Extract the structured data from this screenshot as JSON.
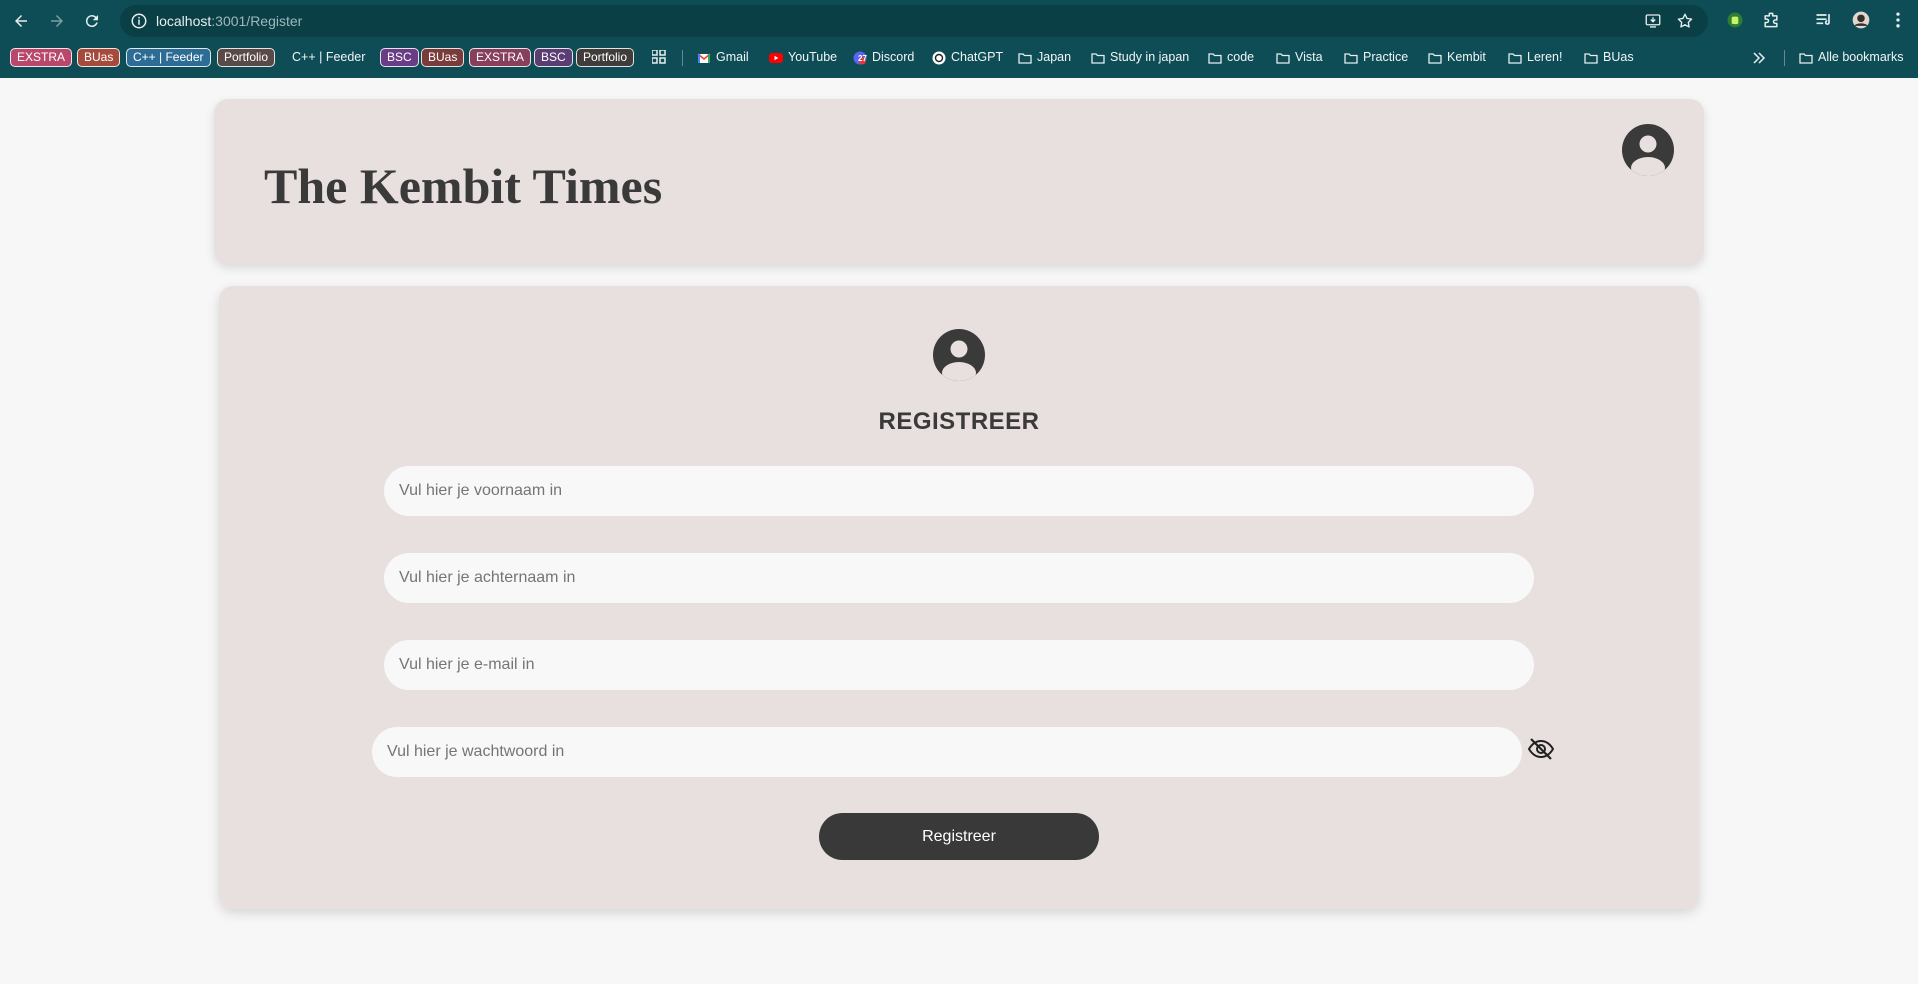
{
  "browser": {
    "url_host": "localhost",
    "url_path": ":3001/Register",
    "bookmarks_tags": [
      {
        "label": "EXSTRA",
        "color": "#b9476c"
      },
      {
        "label": "BUas",
        "color": "#a64a3c"
      },
      {
        "label": "C++ | Feeder",
        "color": "#2d6d95"
      },
      {
        "label": "Portfolio",
        "color": "#5a4a47"
      },
      {
        "label": "C++ | Feeder",
        "color": "transparent"
      },
      {
        "label": "BSC",
        "color": "#6b3c86"
      },
      {
        "label": "BUas",
        "color": "#7a3b3b"
      },
      {
        "label": "EXSTRA",
        "color": "#873f5c"
      },
      {
        "label": "BSC",
        "color": "#5b3d74"
      },
      {
        "label": "Portfolio",
        "color": "#3f3c3b"
      }
    ],
    "bookmark_links": [
      {
        "label": "Gmail",
        "icon": "gmail-icon"
      },
      {
        "label": "YouTube",
        "icon": "youtube-icon"
      },
      {
        "label": "Discord",
        "icon": "discord-icon"
      },
      {
        "label": "ChatGPT",
        "icon": "chatgpt-icon"
      },
      {
        "label": "Japan",
        "icon": "folder-icon"
      },
      {
        "label": "Study in japan",
        "icon": "folder-icon"
      },
      {
        "label": "code",
        "icon": "folder-icon"
      },
      {
        "label": "Vista",
        "icon": "folder-icon"
      },
      {
        "label": "Practice",
        "icon": "folder-icon"
      },
      {
        "label": "Kembit",
        "icon": "folder-icon"
      },
      {
        "label": "Leren!",
        "icon": "folder-icon"
      },
      {
        "label": "BUas",
        "icon": "folder-icon"
      }
    ],
    "all_bookmarks": "Alle bookmarks",
    "discord_badge": "27"
  },
  "header": {
    "title": "The Kembit Times"
  },
  "form": {
    "title": "REGISTREER",
    "first_name_placeholder": "Vul hier je voornaam in",
    "last_name_placeholder": "Vul hier je achternaam in",
    "email_placeholder": "Vul hier je e-mail in",
    "password_placeholder": "Vul hier je wachtwoord in",
    "submit_label": "Registreer"
  },
  "colors": {
    "chrome_bg": "#0e4d55",
    "card_bg": "#e8e0de",
    "field_bg": "#f8f8f8",
    "button_bg": "#393939",
    "text_dark": "#3a3a3a"
  }
}
